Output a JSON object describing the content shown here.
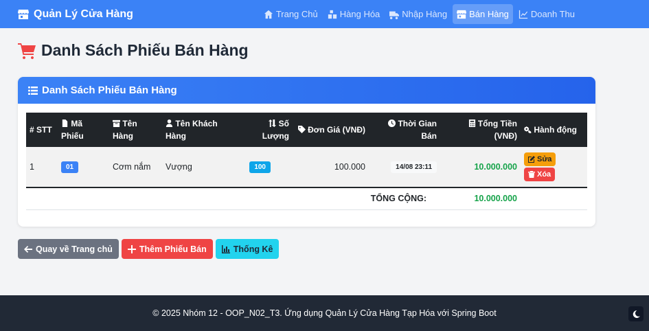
{
  "nav": {
    "brand": "Quản Lý Cửa Hàng",
    "items": [
      {
        "label": "Trang Chủ",
        "icon": "home-icon"
      },
      {
        "label": "Hàng Hóa",
        "icon": "boxes-icon"
      },
      {
        "label": "Nhập Hàng",
        "icon": "truck-icon"
      },
      {
        "label": "Bán Hàng",
        "icon": "store-icon",
        "active": true
      },
      {
        "label": "Doanh Thu",
        "icon": "chart-line-icon"
      }
    ]
  },
  "page": {
    "title": "Danh Sách Phiếu Bán Hàng"
  },
  "card": {
    "title": "Danh Sách Phiếu Bán Hàng",
    "columns": {
      "stt": "# STT",
      "ma_phieu": "Mã Phiếu",
      "ten_hang": "Tên Hàng",
      "ten_khach_hang": "Tên Khách Hàng",
      "so_luong": "Số Lượng",
      "don_gia": "Đơn Giá (VNĐ)",
      "thoi_gian_ban": "Thời Gian Bán",
      "tong_tien": "Tổng Tiền (VNĐ)",
      "hanh_dong": "Hành động"
    },
    "rows": [
      {
        "stt": "1",
        "ma_phieu": "01",
        "ten_hang": "Cơm nắm",
        "ten_khach_hang": "Vượng",
        "so_luong": "100",
        "don_gia": "100.000",
        "thoi_gian_ban": "14/08 23:11",
        "tong_tien": "10.000.000",
        "edit_label": "Sửa",
        "delete_label": "Xóa"
      }
    ],
    "total_label": "TỔNG CỘNG:",
    "total_value": "10.000.000"
  },
  "actions": {
    "back": "Quay về Trang chủ",
    "add": "Thêm Phiếu Bán",
    "stats": "Thống Kê"
  },
  "footer": {
    "text": "© 2025 Nhóm 12 - OOP_N02_T3. Ứng dụng Quản Lý Cửa Hàng Tạp Hóa với Spring Boot"
  },
  "colors": {
    "primary": "#3b82f6",
    "danger": "#ef4444",
    "warning": "#f59e0b",
    "info": "#22d3ee",
    "success": "#16a34a"
  }
}
